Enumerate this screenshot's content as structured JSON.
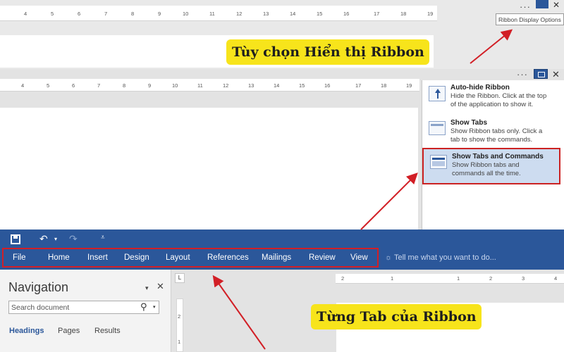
{
  "top_panel": {
    "ruler_numbers": [
      "4",
      "5",
      "6",
      "7",
      "8",
      "9",
      "10",
      "11",
      "12",
      "13",
      "14",
      "15",
      "16",
      "17",
      "18",
      "19"
    ],
    "tooltip": "Ribbon Display Options",
    "overflow_dots": "···",
    "close_glyph": "✕"
  },
  "callouts": {
    "ribbon_options": "Tùy chọn Hiển thị Ribbon",
    "ribbon_tabs": "Từng Tab của Ribbon"
  },
  "middle_panel": {
    "ruler_numbers": [
      "4",
      "5",
      "6",
      "7",
      "8",
      "9",
      "10",
      "11",
      "12",
      "13",
      "14",
      "15",
      "16",
      "17",
      "18",
      "19"
    ],
    "overflow_dots": "···",
    "close_glyph": "✕",
    "menu": [
      {
        "title": "Auto-hide Ribbon",
        "desc": [
          "Hide the Ribbon. Click at the top",
          "of the application to show it."
        ]
      },
      {
        "title": "Show Tabs",
        "desc": [
          "Show Ribbon tabs only. Click a",
          "tab to show the commands."
        ]
      },
      {
        "title": "Show Tabs and Commands",
        "desc": [
          "Show Ribbon tabs and",
          "commands all the time."
        ]
      }
    ]
  },
  "word": {
    "undo_glyph": "↶",
    "undo_arrow": "▾",
    "redo_glyph": "↷",
    "customize_glyph": "⩡",
    "tabs": [
      "File",
      "Home",
      "Insert",
      "Design",
      "Layout",
      "References",
      "Mailings",
      "Review",
      "View"
    ],
    "tell_me": "Tell me what you want to do...",
    "navigation": {
      "title": "Navigation",
      "pin": "▾",
      "close": "✕",
      "search_placeholder": "Search document",
      "search_glyph": "⚲",
      "search_dropdown": "▾",
      "tabs": [
        "Headings",
        "Pages",
        "Results"
      ]
    },
    "corner_glyph": "L",
    "ruler_numbers": [
      "2",
      "1",
      "1",
      "2",
      "3",
      "4"
    ],
    "vruler_numbers": [
      "2",
      "1"
    ]
  },
  "colors": {
    "word_blue": "#2b579a",
    "highlight_red": "#d21f26",
    "callout_yellow": "#f7e41b",
    "menu_selected": "#cddcf0"
  }
}
